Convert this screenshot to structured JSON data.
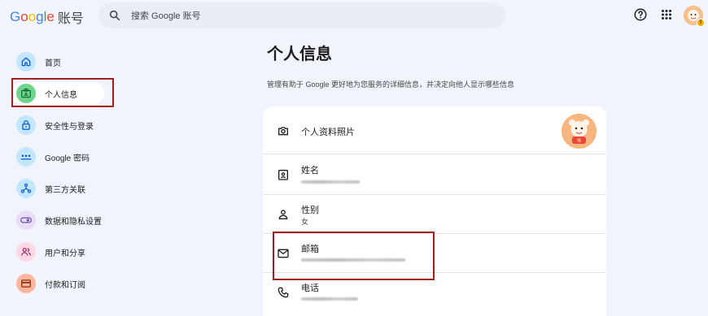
{
  "header": {
    "logo_brand": [
      "G",
      "o",
      "o",
      "g",
      "l",
      "e"
    ],
    "logo_suffix": "账号",
    "search_placeholder": "搜索 Google 账号",
    "icons": [
      "help-icon",
      "apps-grid-icon",
      "account-avatar-icon"
    ]
  },
  "sidebar": {
    "items": [
      {
        "label": "首页",
        "icon": "home-icon",
        "circle_color": "#c2e7ff",
        "icon_color": "#0b57d0"
      },
      {
        "label": "个人信息",
        "icon": "id-card-icon",
        "circle_color": "#6dd58c",
        "icon_color": "#0d652d",
        "active": true
      },
      {
        "label": "安全性与登录",
        "icon": "lock-icon",
        "circle_color": "#c2e7ff",
        "icon_color": "#0b57d0"
      },
      {
        "label": "Google 密码",
        "icon": "password-icon",
        "circle_color": "#c2e7ff",
        "icon_color": "#0b57d0"
      },
      {
        "label": "第三方关联",
        "icon": "connections-icon",
        "circle_color": "#c2e7ff",
        "icon_color": "#0b57d0"
      },
      {
        "label": "数据和隐私设置",
        "icon": "toggle-icon",
        "circle_color": "#e8def8",
        "icon_color": "#6750a4"
      },
      {
        "label": "用户和分享",
        "icon": "people-icon",
        "circle_color": "#ffd8e4",
        "icon_color": "#8c1d62"
      },
      {
        "label": "付款和订阅",
        "icon": "wallet-icon",
        "circle_color": "#ffb59e",
        "icon_color": "#8a2e0b"
      }
    ]
  },
  "main": {
    "title": "个人信息",
    "description": "管理有助于 Google 更好地为您服务的详细信息，并决定向他人显示哪些信息",
    "rows": {
      "photo": {
        "title": "个人资料照片"
      },
      "name": {
        "title": "姓名"
      },
      "gender": {
        "title": "性别",
        "value": "女"
      },
      "email": {
        "title": "邮箱"
      },
      "phone": {
        "title": "电话"
      }
    }
  },
  "colors": {
    "background": "#f1f4fb",
    "highlight": "#a51d1d",
    "card": "#ffffff"
  }
}
